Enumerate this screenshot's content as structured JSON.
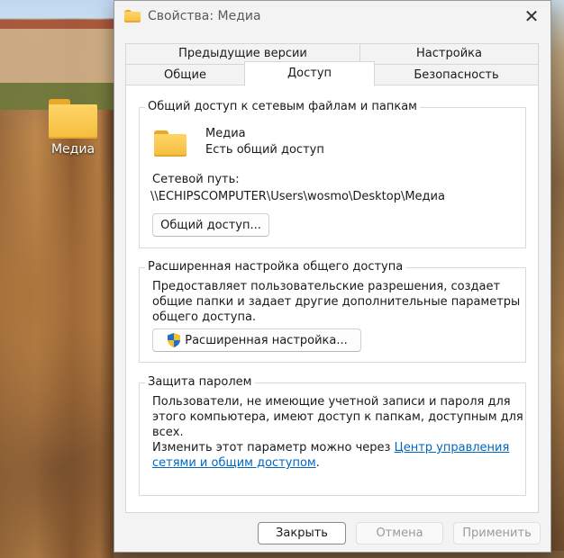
{
  "desktop": {
    "icon_label": "Медиа"
  },
  "dialog": {
    "title": "Свойства: Медиа",
    "close_glyph": "✕"
  },
  "tabs": {
    "row1": [
      "Предыдущие версии",
      "Настройка"
    ],
    "row2": [
      "Общие",
      "Доступ",
      "Безопасность"
    ],
    "active": "Доступ"
  },
  "network_share": {
    "group_title": "Общий доступ к сетевым файлам и папкам",
    "folder_name": "Медиа",
    "share_status": "Есть общий доступ",
    "path_label": "Сетевой путь:",
    "path_value": "\\\\ECHIPSCOMPUTER\\Users\\wosmo\\Desktop\\Медиа",
    "share_button": "Общий доступ..."
  },
  "advanced_share": {
    "group_title": "Расширенная настройка общего доступа",
    "description_1": "Предоставляет пользовательские разрешения, создает",
    "description_2": "общие папки и задает другие дополнительные параметры",
    "description_3": "общего доступа.",
    "button": "Расширенная настройка..."
  },
  "password_protection": {
    "group_title": "Защита паролем",
    "description_1": "Пользователи, не имеющие учетной записи и пароля для",
    "description_2": "этого компьютера, имеют доступ к папкам, доступным для",
    "description_3": "всех.",
    "change_text": "Изменить этот параметр можно через ",
    "link_line_1": "Центр управления",
    "link_line_2": "сетями и общим доступом",
    "trailing": "."
  },
  "footer": {
    "close": "Закрыть",
    "cancel": "Отмена",
    "apply": "Применить"
  },
  "colors": {
    "link": "#0067c0",
    "folder": "#f5be3d",
    "shield_blue": "#1f6fd0",
    "shield_yellow": "#f2c12e"
  }
}
